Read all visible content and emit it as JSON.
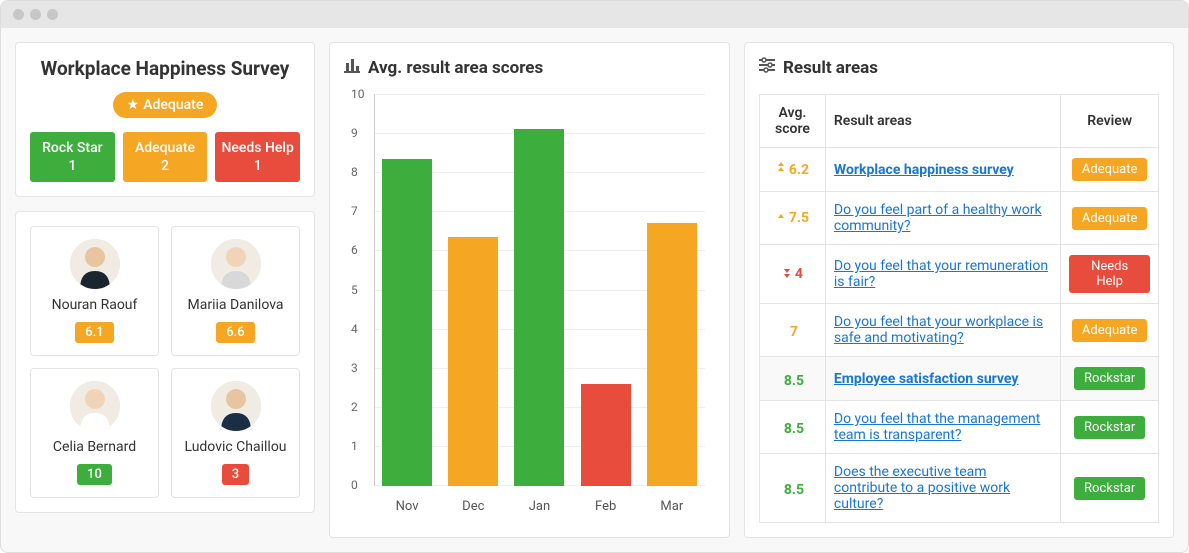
{
  "survey": {
    "title": "Workplace Happiness Survey",
    "pill_label": "Adequate"
  },
  "status_summary": [
    {
      "label": "Rock Star",
      "count": "1",
      "color": "green"
    },
    {
      "label": "Adequate",
      "count": "2",
      "color": "orange"
    },
    {
      "label": "Needs Help",
      "count": "1",
      "color": "red"
    }
  ],
  "people": [
    {
      "name": "Nouran Raouf",
      "score": "6.1",
      "score_color": "orange"
    },
    {
      "name": "Mariia Danilova",
      "score": "6.6",
      "score_color": "orange"
    },
    {
      "name": "Celia Bernard",
      "score": "10",
      "score_color": "green"
    },
    {
      "name": "Ludovic Chaillou",
      "score": "3",
      "score_color": "red"
    }
  ],
  "chart_title": "Avg. result area scores",
  "chart_data": {
    "type": "bar",
    "categories": [
      "Nov",
      "Dec",
      "Jan",
      "Feb",
      "Mar"
    ],
    "values": [
      8.35,
      6.35,
      9.1,
      2.6,
      6.7
    ],
    "colors": [
      "green",
      "orange",
      "green",
      "red",
      "orange"
    ],
    "title": "Avg. result area scores",
    "xlabel": "",
    "ylabel": "",
    "ylim": [
      0,
      10
    ],
    "yticks": [
      0,
      1,
      2,
      3,
      4,
      5,
      6,
      7,
      8,
      9,
      10
    ]
  },
  "results_title": "Result areas",
  "results_headers": {
    "score": "Avg. score",
    "areas": "Result areas",
    "review": "Review"
  },
  "results_rows": [
    {
      "score": "6.2",
      "score_color": "#f5a623",
      "trend": "up-double",
      "area": "Workplace happiness survey",
      "bold": true,
      "review": "Adequate",
      "review_color": "orange"
    },
    {
      "score": "7.5",
      "score_color": "#f5a623",
      "trend": "up",
      "area": "Do you feel part of a healthy work community?",
      "bold": false,
      "review": "Adequate",
      "review_color": "orange"
    },
    {
      "score": "4",
      "score_color": "#e74c3c",
      "trend": "down-double",
      "area": "Do you feel that your remuneration is fair?",
      "bold": false,
      "review": "Needs Help",
      "review_color": "red"
    },
    {
      "score": "7",
      "score_color": "#f5a623",
      "trend": "none",
      "area": "Do you feel that your workplace is safe and motivating?",
      "bold": false,
      "review": "Adequate",
      "review_color": "orange"
    },
    {
      "score": "8.5",
      "score_color": "#3dad3d",
      "trend": "none",
      "area": "Employee satisfaction survey",
      "bold": true,
      "review": "Rockstar",
      "review_color": "green",
      "alt": true
    },
    {
      "score": "8.5",
      "score_color": "#3dad3d",
      "trend": "none",
      "area": "Do you feel that the management team is transparent?",
      "bold": false,
      "review": "Rockstar",
      "review_color": "green"
    },
    {
      "score": "8.5",
      "score_color": "#3dad3d",
      "trend": "none",
      "area": "Does the executive team contribute to a positive work culture?",
      "bold": false,
      "review": "Rockstar",
      "review_color": "green"
    }
  ],
  "chart_color_map": {
    "green": "#3dad3d",
    "orange": "#f5a623",
    "red": "#e74c3c"
  }
}
